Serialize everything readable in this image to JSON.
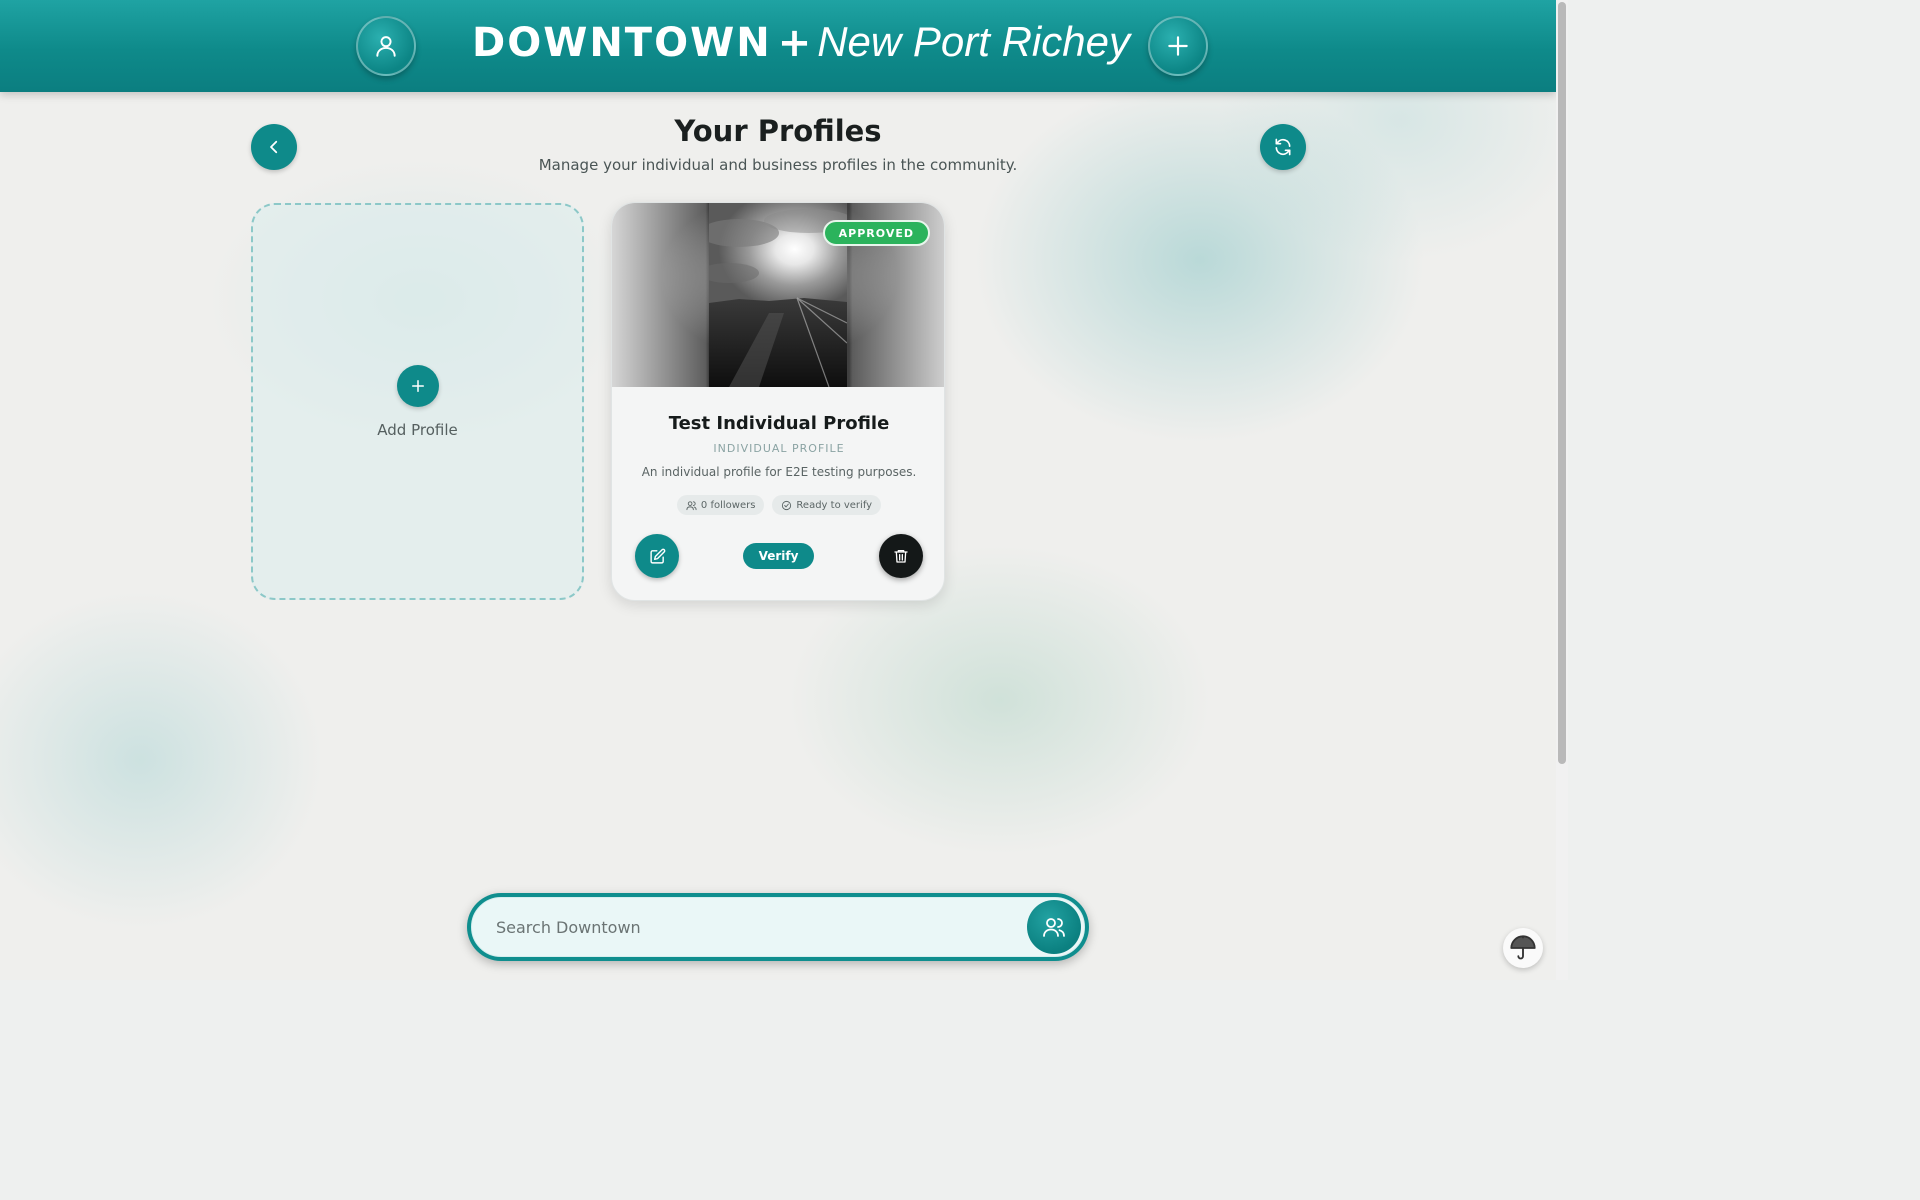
{
  "header": {
    "brand_main": "DOWNTOWN",
    "brand_plus": "+",
    "brand_sub": "New Port Richey",
    "left_button_icon": "user-icon",
    "right_button_icon": "plus-icon"
  },
  "page": {
    "title": "Your Profiles",
    "subtitle": "Manage your individual and business profiles in the community.",
    "back_icon": "chevron-left-icon",
    "refresh_icon": "refresh-icon"
  },
  "add_card": {
    "label": "Add Profile",
    "icon": "plus-icon"
  },
  "profile_card": {
    "status_badge": "APPROVED",
    "name": "Test Individual Profile",
    "kind": "INDIVIDUAL PROFILE",
    "description": "An individual profile for E2E testing purposes.",
    "followers": "0 followers",
    "verify_status": "Ready to verify",
    "verify_label": "Verify",
    "edit_icon": "edit-icon",
    "delete_icon": "trash-icon"
  },
  "search": {
    "placeholder": "Search Downtown",
    "value": "",
    "button_icon": "users-icon"
  },
  "corner_button_icon": "umbrella-icon",
  "colors": {
    "primary_teal": "#0e8a8a",
    "badge_green": "#2bb35c",
    "delete_dark": "#141818"
  }
}
